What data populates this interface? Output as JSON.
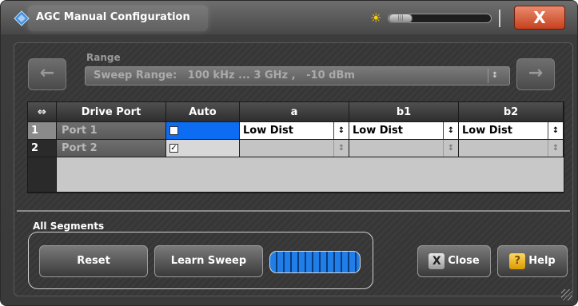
{
  "window": {
    "title": "AGC Manual Configuration",
    "close_symbol": "X"
  },
  "brightness": {
    "thumb_glyph": "|||"
  },
  "range": {
    "label": "Range",
    "value": "Sweep Range:   100 kHz ... 3 GHz ,   -10 dBm",
    "prev_symbol": "←",
    "next_symbol": "→",
    "spin_symbol": "↕"
  },
  "table": {
    "corner_symbol": "⇔",
    "headers": [
      "Drive Port",
      "Auto",
      "a",
      "b1",
      "b2"
    ],
    "rows": [
      {
        "num": "1",
        "port": "Port 1",
        "auto_checked": false,
        "a": "Low Dist",
        "b1": "Low Dist",
        "b2": "Low Dist"
      },
      {
        "num": "2",
        "port": "Port 2",
        "auto_checked": true,
        "a": "",
        "b1": "",
        "b2": ""
      }
    ],
    "check_glyph": "✓",
    "spin_symbol": "↕"
  },
  "segments": {
    "label": "All Segments",
    "reset_label": "Reset",
    "learn_label": "Learn Sweep",
    "progress": 1.0
  },
  "buttons": {
    "close_label": "Close",
    "close_icon_glyph": "X",
    "help_label": "Help",
    "help_icon_glyph": "?"
  },
  "colors": {
    "selection": "#0c6cf2",
    "progress": "#1f7ee8",
    "sun": "#ffd400",
    "title_close": "#c6401f"
  }
}
